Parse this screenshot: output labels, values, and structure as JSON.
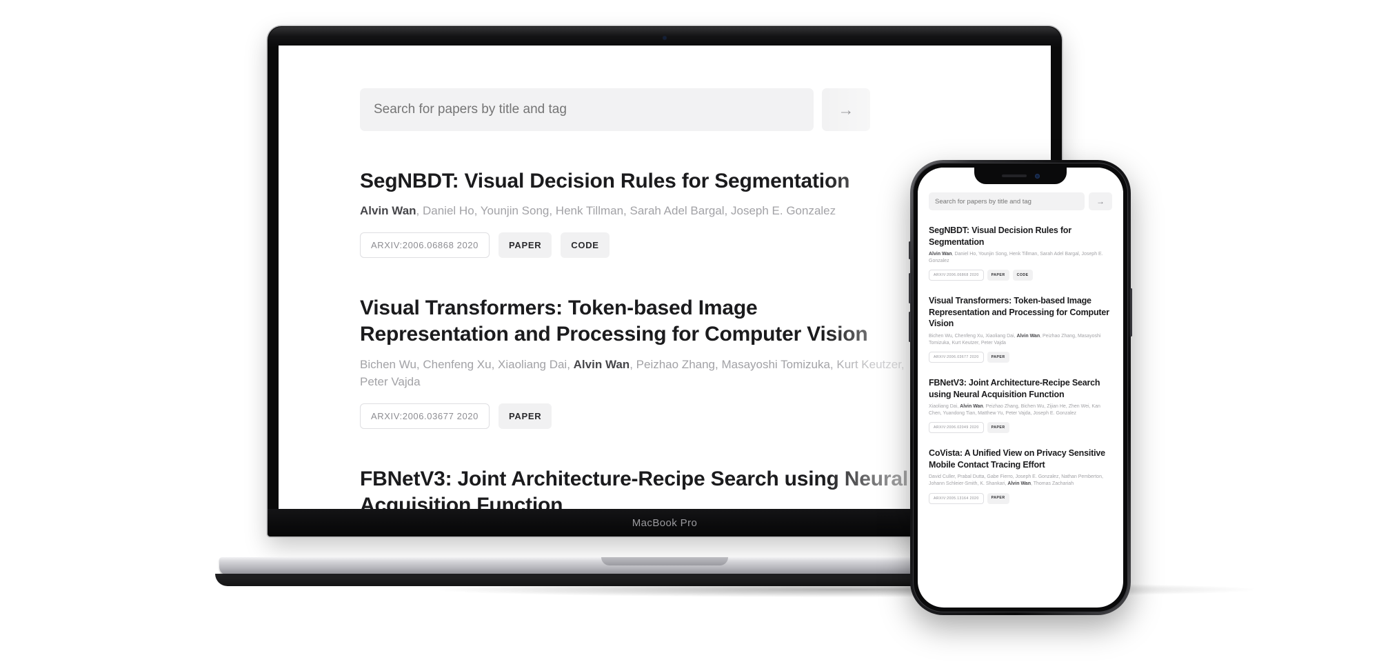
{
  "search": {
    "placeholder": "Search for papers by title and tag",
    "value": "",
    "submit_icon": "→"
  },
  "device_labels": {
    "laptop": "MacBook Pro"
  },
  "papers": [
    {
      "title": "SegNBDT: Visual Decision Rules for Segmentation",
      "authors_pre": "",
      "authors_highlight": "Alvin Wan",
      "authors_post": ", Daniel Ho, Younjin Song, Henk Tillman, Sarah Adel Bargal, Joseph E. Gonzalez",
      "arxiv_tag": "ARXIV:2006.06868 2020",
      "links": [
        "PAPER",
        "CODE"
      ]
    },
    {
      "title": "Visual Transformers: Token-based Image Representation and Processing for Computer Vision",
      "authors_pre": "Bichen Wu, Chenfeng Xu, Xiaoliang Dai, ",
      "authors_highlight": "Alvin Wan",
      "authors_post": ", Peizhao Zhang, Masayoshi Tomizuka, Kurt Keutzer, Peter Vajda",
      "arxiv_tag": "ARXIV:2006.03677 2020",
      "links": [
        "PAPER"
      ]
    },
    {
      "title": "FBNetV3: Joint Architecture-Recipe Search using Neural Acquisition Function",
      "authors_pre": "Xiaoliang Dai, ",
      "authors_highlight": "Alvin Wan",
      "authors_post": ", Peizhao Zhang, Bichen Wu, Zijian He, Zhen Wei, Kan Chen, Yuandong Tian, Matthew Yu, Peter Vajda, Joseph E. Gonzalez",
      "arxiv_tag": "ARXIV:2006.02049 2020",
      "links": [
        "PAPER"
      ]
    },
    {
      "title": "CoVista: A Unified View on Privacy Sensitive Mobile Contact Tracing Effort",
      "authors_pre": "David Culler, Prabal Dutta, Gabe Fierro, Joseph E. Gonzalez, Nathan Pemberton, Johann Schleier-Smith, K. Shankari, ",
      "authors_highlight": "Alvin Wan",
      "authors_post": ", Thomas Zachariah",
      "arxiv_tag": "ARXIV:2005.13164 2020",
      "links": [
        "PAPER"
      ]
    }
  ],
  "colors": {
    "page_background": "#ffffff",
    "search_field": "#f2f2f3",
    "placeholder_text": "#9b9b9e",
    "title_text": "#1b1b1d",
    "author_text": "#a2a2a6",
    "author_highlight": "#46464a",
    "tag_fill": "#f1f1f2",
    "tag_border": "#dedee1"
  }
}
